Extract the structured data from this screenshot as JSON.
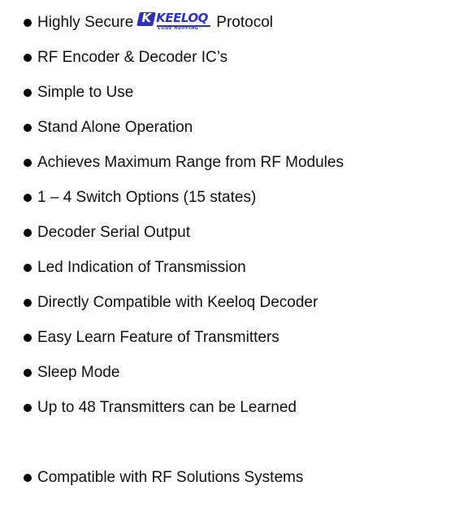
{
  "features": {
    "item_1": {
      "prefix": "Highly Secure",
      "logo_letter": "K",
      "logo_word": "KEELOQ",
      "logo_subtitle": "CODE HOPPING",
      "suffix": "Protocol"
    },
    "items": [
      "RF Encoder & Decoder IC’s",
      "Simple to Use",
      "Stand Alone Operation",
      "Achieves Maximum Range from RF Modules",
      "1 – 4 Switch Options (15 states)",
      "Decoder Serial Output",
      "Led Indication of Transmission",
      "Directly Compatible with Keeloq Decoder",
      "Easy Learn Feature of Transmitters",
      "Sleep Mode",
      "Up to 48 Transmitters can be Learned",
      "Compatible with RF Solutions Systems"
    ]
  },
  "colors": {
    "text": "#111111",
    "bullet": "#000000",
    "logo_blue": "#2b33b8"
  }
}
